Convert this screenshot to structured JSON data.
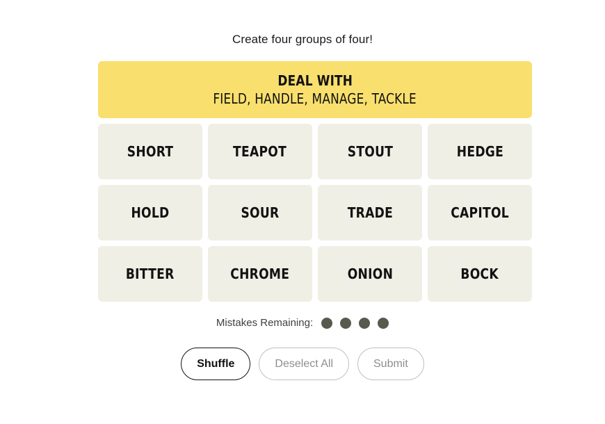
{
  "header": {
    "instruction": "Create four groups of four!"
  },
  "board": {
    "solved_groups": [
      {
        "category": "DEAL WITH",
        "members_text": "FIELD, HANDLE, MANAGE, TACKLE",
        "color": "#f9df6d"
      }
    ],
    "tile_rows": [
      [
        {
          "label": "SHORT"
        },
        {
          "label": "TEAPOT"
        },
        {
          "label": "STOUT"
        },
        {
          "label": "HEDGE"
        }
      ],
      [
        {
          "label": "HOLD"
        },
        {
          "label": "SOUR"
        },
        {
          "label": "TRADE"
        },
        {
          "label": "CAPITOL"
        }
      ],
      [
        {
          "label": "BITTER"
        },
        {
          "label": "CHROME"
        },
        {
          "label": "ONION"
        },
        {
          "label": "BOCK"
        }
      ]
    ],
    "tile_background": "#efefe6"
  },
  "mistakes": {
    "label": "Mistakes Remaining:",
    "remaining": 4,
    "dot_color": "#5a594e"
  },
  "controls": {
    "shuffle": {
      "label": "Shuffle",
      "enabled": true
    },
    "deselect_all": {
      "label": "Deselect All",
      "enabled": false
    },
    "submit": {
      "label": "Submit",
      "enabled": false
    }
  }
}
